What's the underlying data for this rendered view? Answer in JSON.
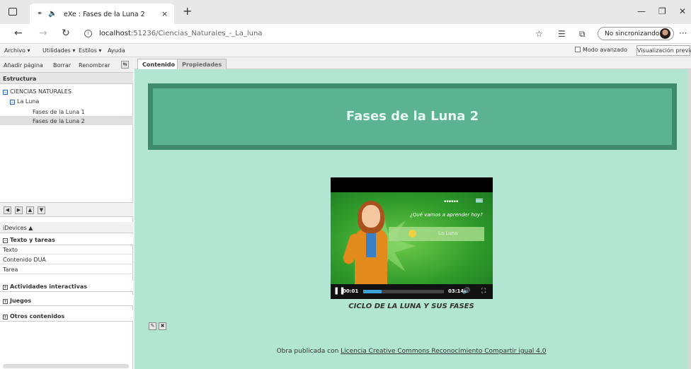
{
  "browser": {
    "tab_title": "eXe : Fases de la Luna 2",
    "tab_close": "×",
    "new_tab": "+",
    "url_host": "localhost",
    "url_rest": ":51236/Ciencias_Naturales_-_La_luna",
    "sync_label": "No sincronizando",
    "more": "···",
    "win_min": "—",
    "win_max": "❐",
    "win_close": "✕"
  },
  "menu": {
    "archivo": "Archivo ▾",
    "utilidades": "Utilidades ▾",
    "estilos": "Estilos ▾",
    "ayuda": "Ayuda",
    "modo_avanzado": "Modo avanzado",
    "visualizacion_previa": "Visualización previa"
  },
  "left": {
    "add_page": "Añadir página",
    "delete": "Borrar",
    "rename": "Renombrar",
    "structure_header": "Estructura",
    "tree": {
      "root": "CIENCIAS NATURALES",
      "child": "La Luna",
      "leaf1": "Fases de la Luna 1",
      "leaf2": "Fases de la Luna 2"
    },
    "idevices_header": "iDevices ▲",
    "categories": {
      "texto_tareas": "Texto y tareas",
      "actividades": "Actividades interactivas",
      "juegos": "Juegos",
      "otros": "Otros contenidos"
    },
    "idevices": [
      "Texto",
      "Contenido DUA",
      "Tarea"
    ]
  },
  "main": {
    "tab_contenido": "Contenido",
    "tab_propiedades": "Propiedades",
    "page_heading": "Fases de la Luna 2",
    "caption": "CICLO DE LA LUNA Y SUS FASES",
    "footer_prefix": "Obra publicada con ",
    "footer_link": "Licencia Creative Commons Reconocimiento Compartir igual 4.0"
  },
  "video": {
    "question": "¿Qué vamos a aprender hoy?",
    "topic": "La Luna",
    "current_time": "00:01",
    "duration": "03:14",
    "progress_fraction": 0.23
  },
  "colors": {
    "content_bg": "#b2e6d2",
    "banner_bg": "#5bb393",
    "banner_border": "#3e8a6d",
    "progress": "#3fa2d6"
  }
}
